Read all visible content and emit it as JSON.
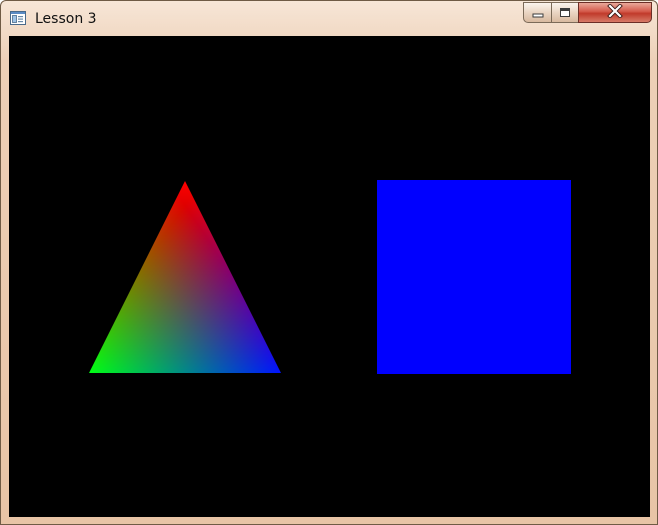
{
  "window": {
    "title": "Lesson 3"
  },
  "icons": {
    "app": "window-app-icon",
    "minimize": "minimize-icon",
    "maximize": "maximize-icon",
    "close": "close-icon"
  },
  "scene": {
    "background_color": "#000000",
    "triangle": {
      "vertex_colors": [
        "#ff0000",
        "#00ff00",
        "#0000ff"
      ]
    },
    "square": {
      "color": "#0000ff"
    }
  }
}
